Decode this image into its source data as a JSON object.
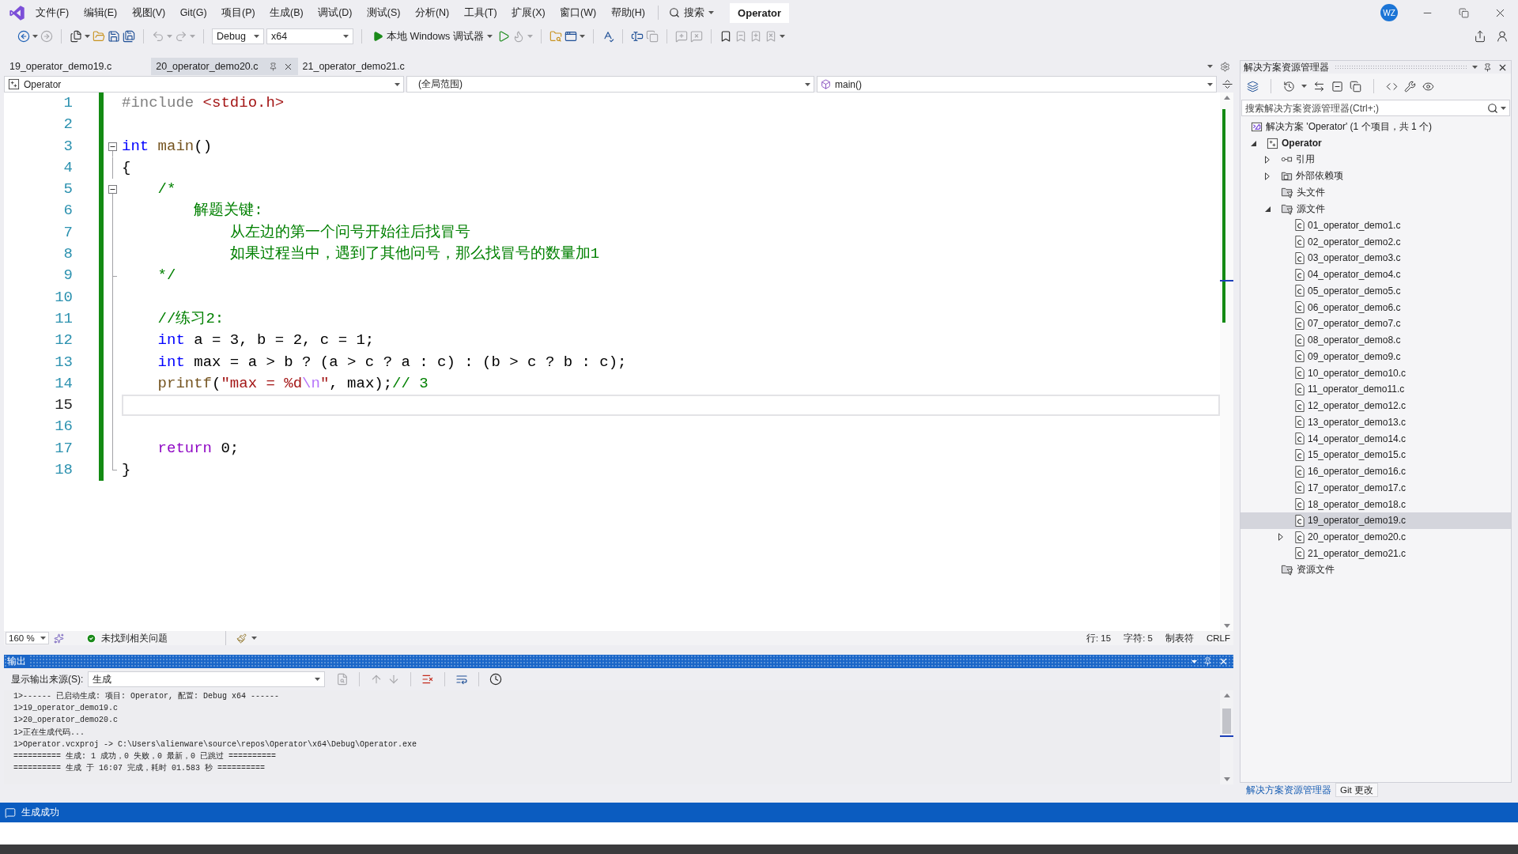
{
  "title_bar": {
    "menu": [
      "文件(F)",
      "编辑(E)",
      "视图(V)",
      "Git(G)",
      "项目(P)",
      "生成(B)",
      "调试(D)",
      "测试(S)",
      "分析(N)",
      "工具(T)",
      "扩展(X)",
      "窗口(W)",
      "帮助(H)"
    ],
    "search": "搜索",
    "solution_name": "Operator",
    "avatar": "WZ"
  },
  "toolbar": {
    "groups": [
      [
        {
          "kind": "back",
          "disabled": false
        },
        {
          "kind": "forward",
          "disabled": true
        }
      ],
      [
        {
          "kind": "new_project",
          "disabled": false
        },
        {
          "kind": "open",
          "disabled": false
        },
        {
          "kind": "save",
          "disabled": false
        },
        {
          "kind": "save_all",
          "disabled": false
        }
      ],
      [
        {
          "kind": "undo",
          "disabled": true
        },
        {
          "kind": "redo",
          "disabled": true
        }
      ],
      [
        {
          "kind": "combo",
          "text": "Debug",
          "disabled": false
        },
        {
          "kind": "combo",
          "text": "x64",
          "disabled": false
        }
      ],
      [
        {
          "kind": "start_debugging",
          "text": "本地 Windows 调试器",
          "disabled": false
        },
        {
          "kind": "start",
          "disabled": false
        },
        {
          "kind": "hot_reload",
          "disabled": true
        }
      ],
      [
        {
          "kind": "find_in_files",
          "disabled": false
        },
        {
          "kind": "browser",
          "disabled": false
        }
      ],
      [
        {
          "kind": "spell_check",
          "disabled": false
        }
      ],
      [
        {
          "kind": "step_cursor",
          "disabled": false
        },
        {
          "kind": "format",
          "disabled": true
        }
      ],
      [
        {
          "kind": "comment",
          "disabled": true
        },
        {
          "kind": "uncomment",
          "disabled": true
        }
      ],
      [
        {
          "kind": "bookmark",
          "disabled": false
        },
        {
          "kind": "prev_bookmark",
          "disabled": true
        },
        {
          "kind": "next_bookmark",
          "disabled": true
        },
        {
          "kind": "clear_bookmarks",
          "disabled": true
        }
      ]
    ]
  },
  "editor": {
    "tabs": [
      {
        "label": "19_operator_demo19.c",
        "selected": false
      },
      {
        "label": "20_operator_demo20.c",
        "selected": true
      },
      {
        "label": "21_operator_demo21.c",
        "selected": false
      }
    ],
    "navigation": {
      "project": "Operator",
      "scope": "(全局范围)",
      "member": "main()"
    },
    "lines": [
      {
        "number": "1",
        "changed": true,
        "current": false,
        "tokens": [
          {
            "kind": "preprocessor",
            "text": "#include"
          },
          {
            "kind": "header",
            "text": " <stdio.h>"
          }
        ]
      },
      {
        "number": "2",
        "changed": true,
        "current": false
      },
      {
        "number": "3",
        "changed": true,
        "current": false,
        "outline": {
          "kind": "fold",
          "expanded": true
        },
        "tokens": [
          {
            "kind": "keyword",
            "text": "int"
          },
          {
            "kind": "function",
            "text": " main"
          },
          {
            "kind": "plain",
            "text": "()"
          }
        ]
      },
      {
        "number": "4",
        "changed": true,
        "current": false,
        "outline": {
          "kind": "inside"
        },
        "tokens": [
          {
            "kind": "plain",
            "text": "{"
          }
        ]
      },
      {
        "number": "5",
        "changed": true,
        "current": false,
        "outline": {
          "kind": "fold",
          "expanded": true
        },
        "tokens": [
          {
            "kind": "comment",
            "text": "\t/*"
          }
        ]
      },
      {
        "number": "6",
        "changed": true,
        "current": false,
        "outline": {
          "kind": "inside"
        },
        "tokens": [
          {
            "kind": "comment",
            "text": "\t\t解题关键:"
          }
        ]
      },
      {
        "number": "7",
        "changed": true,
        "current": false,
        "outline": {
          "kind": "inside"
        },
        "tokens": [
          {
            "kind": "comment",
            "text": "\t\t\t从左边的第一个问号开始往后找冒号"
          }
        ]
      },
      {
        "number": "8",
        "changed": true,
        "current": false,
        "outline": {
          "kind": "inside"
        },
        "tokens": [
          {
            "kind": "comment",
            "text": "\t\t\t如果过程当中，遇到了其他问号，那么找冒号的数量加1"
          }
        ]
      },
      {
        "number": "9",
        "changed": true,
        "current": false,
        "outline": {
          "kind": "inner_end"
        },
        "tokens": [
          {
            "kind": "comment",
            "text": "\t*/"
          }
        ]
      },
      {
        "number": "10",
        "changed": true,
        "current": false,
        "outline": {
          "kind": "inside"
        }
      },
      {
        "number": "11",
        "changed": true,
        "current": false,
        "outline": {
          "kind": "inside"
        },
        "tokens": [
          {
            "kind": "comment",
            "text": "\t//练习2:"
          }
        ]
      },
      {
        "number": "12",
        "changed": true,
        "current": false,
        "outline": {
          "kind": "inside"
        },
        "tokens": [
          {
            "kind": "keyword",
            "text": "\tint"
          },
          {
            "kind": "plain",
            "text": " a = 3, b = 2, c = 1;"
          }
        ]
      },
      {
        "number": "13",
        "changed": true,
        "current": false,
        "outline": {
          "kind": "inside"
        },
        "tokens": [
          {
            "kind": "keyword",
            "text": "\tint"
          },
          {
            "kind": "plain",
            "text": " max = a > b ? (a > c ? a : c) : (b > c ? b : c);"
          }
        ]
      },
      {
        "number": "14",
        "changed": true,
        "current": false,
        "outline": {
          "kind": "inside"
        },
        "tokens": [
          {
            "kind": "function",
            "text": "\tprintf"
          },
          {
            "kind": "plain",
            "text": "("
          },
          {
            "kind": "string",
            "text": "\"max = %d"
          },
          {
            "kind": "escape",
            "text": "\\n"
          },
          {
            "kind": "string",
            "text": "\""
          },
          {
            "kind": "plain",
            "text": ", max);"
          },
          {
            "kind": "comment",
            "text": "// 3"
          }
        ]
      },
      {
        "number": "15",
        "changed": true,
        "current": true,
        "outline": {
          "kind": "inside"
        }
      },
      {
        "number": "16",
        "changed": true,
        "current": false,
        "outline": {
          "kind": "inside"
        }
      },
      {
        "number": "17",
        "changed": true,
        "current": false,
        "outline": {
          "kind": "inside"
        },
        "tokens": [
          {
            "kind": "control",
            "text": "\treturn"
          },
          {
            "kind": "plain",
            "text": " 0;"
          }
        ]
      },
      {
        "number": "18",
        "changed": true,
        "current": false,
        "outline": {
          "kind": "end"
        },
        "tokens": [
          {
            "kind": "plain",
            "text": "}"
          }
        ]
      }
    ],
    "status": {
      "zoom": "160 %",
      "issues": "未找到相关问题",
      "line": "行: 15",
      "column": "字符: 5",
      "indent": "制表符",
      "line_ending": "CRLF"
    }
  },
  "output": {
    "title": "输出",
    "source_label": "显示输出来源(S):",
    "source": "生成",
    "toolbar": [
      {
        "kind": "find",
        "disabled": true
      },
      {
        "kind": "previous",
        "disabled": true
      },
      {
        "kind": "next",
        "disabled": true
      },
      {
        "kind": "clear",
        "disabled": false
      },
      {
        "kind": "wrap",
        "disabled": false
      },
      {
        "kind": "timestamps",
        "disabled": false
      }
    ],
    "lines": [
      "1>------ 已启动生成: 项目: Operator, 配置: Debug x64 ------",
      "1>19_operator_demo19.c",
      "1>20_operator_demo20.c",
      "1>正在生成代码...",
      "1>Operator.vcxproj -> C:\\Users\\alienware\\source\\repos\\Operator\\x64\\Debug\\Operator.exe",
      "========== 生成: 1 成功，0 失败，0 最新，0 已跳过 ==========",
      "========== 生成 于 16:07 完成，耗时 01.583 秒 =========="
    ]
  },
  "solution_explorer": {
    "title": "解决方案资源管理器",
    "search": {
      "placeholder": "搜索解决方案资源管理器(Ctrl+;)"
    },
    "tree": [
      {
        "kind": "solution",
        "label": "解决方案 'Operator' (1 个项目，共 1 个)",
        "selected": false,
        "children": [
          {
            "kind": "project",
            "label": "Operator",
            "expanded": true,
            "selected": false,
            "children": [
              {
                "kind": "references",
                "label": "引用",
                "expanded": false,
                "selected": false
              },
              {
                "kind": "dependencies",
                "label": "外部依赖项",
                "expanded": false,
                "selected": false
              },
              {
                "kind": "folder",
                "label": "头文件",
                "selected": false
              },
              {
                "kind": "folder",
                "label": "源文件",
                "expanded": true,
                "selected": false,
                "children": [
                  {
                    "kind": "file",
                    "label": "01_operator_demo1.c",
                    "selected": false
                  },
                  {
                    "kind": "file",
                    "label": "02_operator_demo2.c",
                    "selected": false
                  },
                  {
                    "kind": "file",
                    "label": "03_operator_demo3.c",
                    "selected": false
                  },
                  {
                    "kind": "file",
                    "label": "04_operator_demo4.c",
                    "selected": false
                  },
                  {
                    "kind": "file",
                    "label": "05_operator_demo5.c",
                    "selected": false
                  },
                  {
                    "kind": "file",
                    "label": "06_operator_demo6.c",
                    "selected": false
                  },
                  {
                    "kind": "file",
                    "label": "07_operator_demo7.c",
                    "selected": false
                  },
                  {
                    "kind": "file",
                    "label": "08_operator_demo8.c",
                    "selected": false
                  },
                  {
                    "kind": "file",
                    "label": "09_operator_demo9.c",
                    "selected": false
                  },
                  {
                    "kind": "file",
                    "label": "10_operator_demo10.c",
                    "selected": false
                  },
                  {
                    "kind": "file",
                    "label": "11_operator_demo11.c",
                    "selected": false
                  },
                  {
                    "kind": "file",
                    "label": "12_operator_demo12.c",
                    "selected": false
                  },
                  {
                    "kind": "file",
                    "label": "13_operator_demo13.c",
                    "selected": false
                  },
                  {
                    "kind": "file",
                    "label": "14_operator_demo14.c",
                    "selected": false
                  },
                  {
                    "kind": "file",
                    "label": "15_operator_demo15.c",
                    "selected": false
                  },
                  {
                    "kind": "file",
                    "label": "16_operator_demo16.c",
                    "selected": false
                  },
                  {
                    "kind": "file",
                    "label": "17_operator_demo17.c",
                    "selected": false
                  },
                  {
                    "kind": "file",
                    "label": "18_operator_demo18.c",
                    "selected": false
                  },
                  {
                    "kind": "file",
                    "label": "19_operator_demo19.c",
                    "selected": true
                  },
                  {
                    "kind": "file",
                    "label": "20_operator_demo20.c",
                    "expanded": false,
                    "selected": false
                  },
                  {
                    "kind": "file",
                    "label": "21_operator_demo21.c",
                    "selected": false
                  }
                ]
              },
              {
                "kind": "folder",
                "label": "资源文件",
                "selected": false
              }
            ]
          }
        ]
      }
    ],
    "tabs": [
      {
        "label": "解决方案资源管理器",
        "selected": true
      },
      {
        "label": "Git 更改",
        "selected": false
      }
    ]
  },
  "status_bar": {
    "message": "生成成功"
  }
}
